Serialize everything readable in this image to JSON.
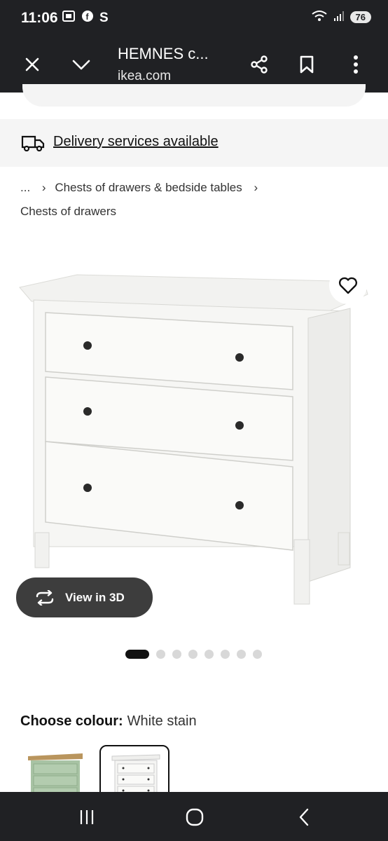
{
  "status": {
    "time": "11:06",
    "app_icons": [
      "screenshot-icon",
      "facebook-icon",
      "S"
    ],
    "battery": "76"
  },
  "browser": {
    "title": "HEMNES c...",
    "url": "ikea.com"
  },
  "delivery": {
    "text": "Delivery services available"
  },
  "breadcrumb": {
    "ellipsis": "...",
    "level1": "Chests of drawers & bedside tables",
    "level2": "Chests of drawers"
  },
  "product": {
    "view3d_label": "View in 3D",
    "images_count": 8,
    "active_image_index": 0
  },
  "colour": {
    "label": "Choose colour:",
    "value": "White stain",
    "options": [
      "green-stain",
      "white-stain"
    ],
    "selected": "white-stain"
  },
  "colors": {
    "bar": "#202124",
    "text": "#111111",
    "panel": "#f5f5f5",
    "view3d_bg": "#3d3d3d"
  }
}
